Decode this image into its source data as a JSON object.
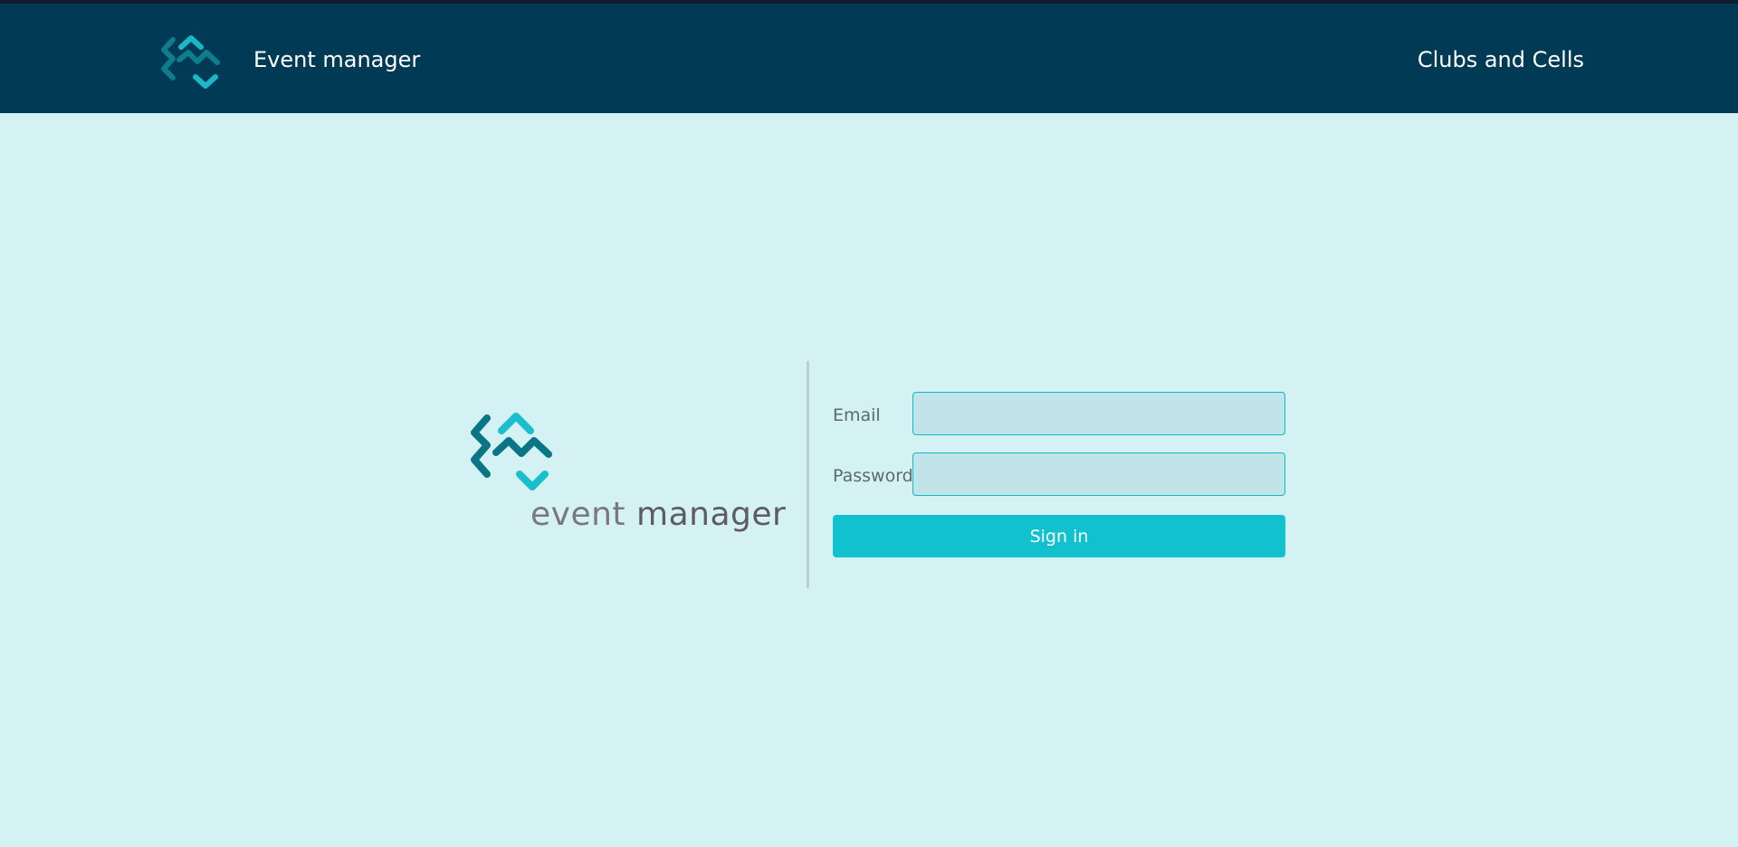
{
  "header": {
    "title": "Event manager",
    "nav_link": "Clubs and Cells",
    "logo_icon": "event-manager-logo"
  },
  "branding": {
    "logo_icon": "event-manager-logo",
    "wordmark_light": "event",
    "wordmark_bold": "manager"
  },
  "login_form": {
    "email_label": "Email",
    "email_value": "",
    "password_label": "Password",
    "password_value": "",
    "submit_label": "Sign in"
  },
  "colors": {
    "header_bg": "#003a55",
    "page_bg": "#d4f1f3",
    "accent": "#11c1ce",
    "logo_dark": "#0a7585",
    "logo_light": "#19bfcc"
  }
}
